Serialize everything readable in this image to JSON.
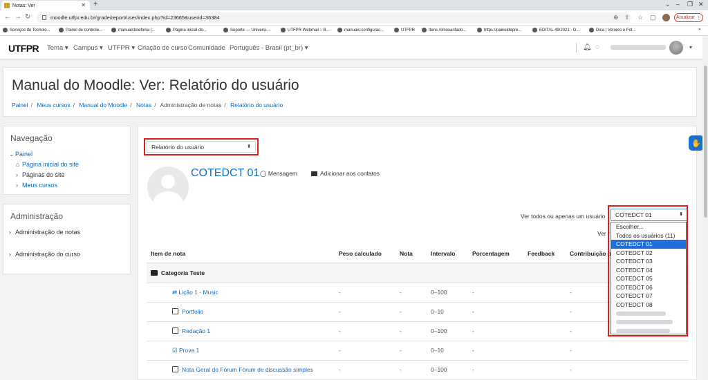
{
  "browser": {
    "tab_title": "Notas: Ver",
    "url": "moodle.utfpr.edu.br/grade/report/user/index.php?id=23665&userid=36384",
    "update_button": "Atualizar",
    "bookmarks": [
      "Serviços de Tecnolo...",
      "Painel de controle...",
      "manuaistelefonia [...",
      "Página inicial do...",
      "Suporte — Universi...",
      "UTFPR Webmail :: B...",
      "manuais:configurac...",
      "UTFPR",
      "Itens Almoxarifado...",
      "https://paineldepre...",
      "EDITAL 49/2021 - D...",
      "Dica | Vetores e Fot..."
    ]
  },
  "navbar": {
    "logo": "UTFPR",
    "links": [
      "Tema",
      "Campus",
      "UTFPR",
      "Criação de curso",
      "Comunidade",
      "Português - Brasil (pt_br)"
    ]
  },
  "header": {
    "title": "Manual do Moodle: Ver: Relatório do usuário",
    "breadcrumb": [
      "Painel",
      "Meus cursos",
      "Manual do Moodle",
      "Notas",
      "Administração de notas",
      "Relatório do usuário"
    ]
  },
  "nav_block": {
    "title": "Navegação",
    "items": [
      "Painel",
      "Página inicial do site",
      "Páginas do site",
      "Meus cursos"
    ]
  },
  "admin_block": {
    "title": "Administração",
    "items": [
      "Administração de notas",
      "Administração do curso"
    ]
  },
  "main": {
    "report_select": "Relatório do usuário",
    "user_name": "COTEDCT 01",
    "message_link": "Mensagem",
    "add_contact_link": "Adicionar aos contatos",
    "view_all_label": "Ver todos ou apenas um usuário",
    "view_label2": "Ver r"
  },
  "table": {
    "headers": [
      "Item de nota",
      "Peso calculado",
      "Nota",
      "Intervalo",
      "Porcentagem",
      "Feedback",
      "Contribuição p"
    ],
    "category": "Categoria Teste",
    "rows": [
      {
        "name": "Lição 1 - Music",
        "peso": "-",
        "nota": "-",
        "intervalo": "0–100",
        "porcentagem": "-",
        "feedback": "",
        "contrib": "-"
      },
      {
        "name": "Portfolio",
        "peso": "-",
        "nota": "-",
        "intervalo": "0–10",
        "porcentagem": "-",
        "feedback": "",
        "contrib": "-"
      },
      {
        "name": "Redação 1",
        "peso": "-",
        "nota": "-",
        "intervalo": "0–100",
        "porcentagem": "-",
        "feedback": "",
        "contrib": "-"
      },
      {
        "name": "Prova 1",
        "peso": "-",
        "nota": "-",
        "intervalo": "0–10",
        "porcentagem": "-",
        "feedback": "",
        "contrib": "-"
      },
      {
        "name": "Nota Geral do Fórum Fórum de discussão simples",
        "peso": "-",
        "nota": "-",
        "intervalo": "0–100",
        "porcentagem": "-",
        "feedback": "",
        "contrib": "-"
      }
    ]
  },
  "user_dropdown": {
    "selected": "COTEDCT 01",
    "options": [
      "Escolher...",
      "Todos os usuários (11)",
      "COTEDCT 01",
      "COTEDCT 02",
      "COTEDCT 03",
      "COTEDCT 04",
      "COTEDCT 05",
      "COTEDCT 06",
      "COTEDCT 07",
      "COTEDCT 08"
    ]
  },
  "colors": {
    "link": "#0f6cbf",
    "highlight": "#e21b1b",
    "selected_option": "#1e6fd9"
  }
}
